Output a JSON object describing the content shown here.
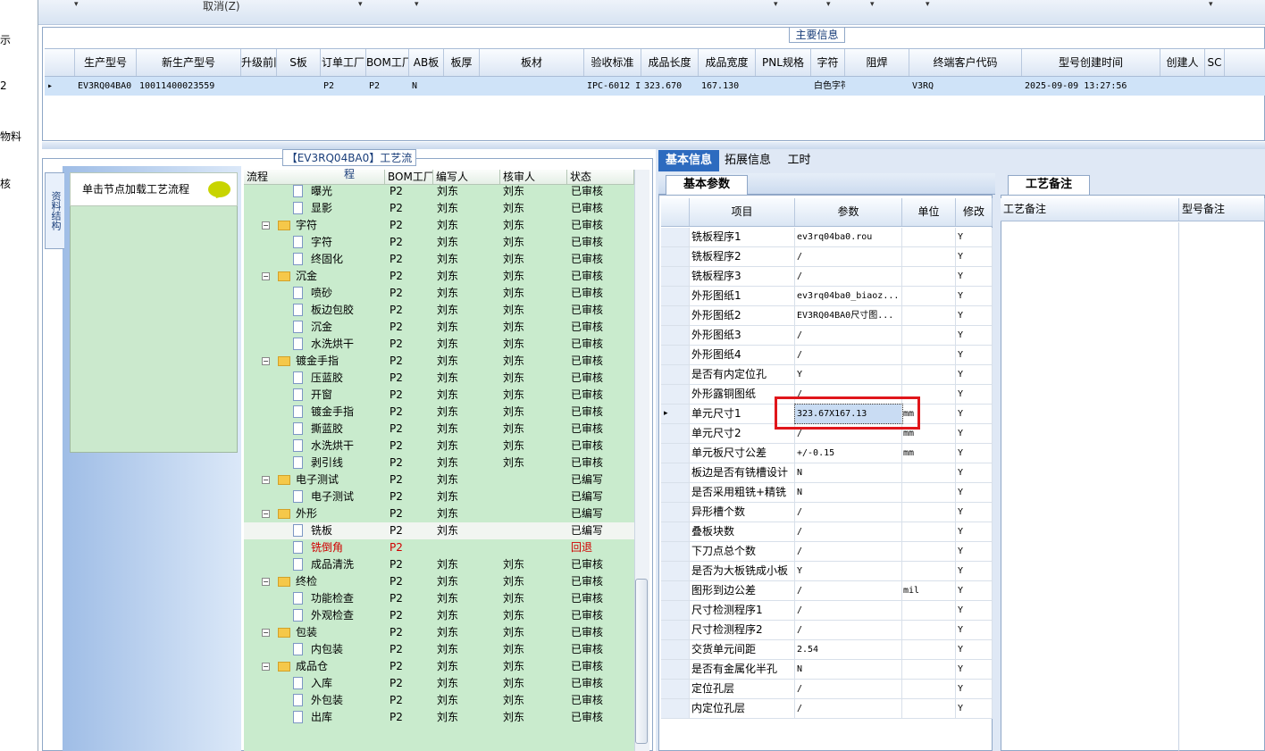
{
  "left_strip": [
    "示",
    "2",
    "物料",
    "核"
  ],
  "toolbar": {
    "cancel_label": "取消(Z)"
  },
  "main_group_title": "主要信息",
  "main_columns": [
    "生产型号",
    "新生产型号",
    "升级前旧生产型号",
    "S板",
    "订单工厂",
    "BOM工厂",
    "AB板",
    "板厚",
    "板材",
    "验收标准",
    "成品长度",
    "成品宽度",
    "PNL规格",
    "字符",
    "阻焊",
    "终端客户代码",
    "型号创建时间",
    "创建人",
    "SC"
  ],
  "main_row": [
    "EV3RQ04BA0",
    "10011400023559",
    "",
    "",
    "P2",
    "P2",
    "N",
    "",
    "",
    "IPC-6012 III级",
    "323.670",
    "167.130",
    "",
    "白色字符",
    "",
    "V3RQ",
    "2025-09-09 13:27:56",
    "",
    ""
  ],
  "process_title": "【EV3RQ04BA0】工艺流程",
  "vertical_tab": "资料结构",
  "hint_text": "单击节点加载工艺流程",
  "tree_columns": [
    "流程",
    "BOM工厂",
    "编写人",
    "核审人",
    "状态"
  ],
  "tree_rows": [
    {
      "level": 2,
      "name": "曝光",
      "bom": "P2",
      "writer": "刘东",
      "reviewer": "刘东",
      "status": "已审核"
    },
    {
      "level": 2,
      "name": "显影",
      "bom": "P2",
      "writer": "刘东",
      "reviewer": "刘东",
      "status": "已审核"
    },
    {
      "level": 1,
      "name": "字符",
      "bom": "P2",
      "writer": "刘东",
      "reviewer": "刘东",
      "status": "已审核"
    },
    {
      "level": 2,
      "name": "字符",
      "bom": "P2",
      "writer": "刘东",
      "reviewer": "刘东",
      "status": "已审核"
    },
    {
      "level": 2,
      "name": "终固化",
      "bom": "P2",
      "writer": "刘东",
      "reviewer": "刘东",
      "status": "已审核"
    },
    {
      "level": 1,
      "name": "沉金",
      "bom": "P2",
      "writer": "刘东",
      "reviewer": "刘东",
      "status": "已审核"
    },
    {
      "level": 2,
      "name": "喷砂",
      "bom": "P2",
      "writer": "刘东",
      "reviewer": "刘东",
      "status": "已审核"
    },
    {
      "level": 2,
      "name": "板边包胶",
      "bom": "P2",
      "writer": "刘东",
      "reviewer": "刘东",
      "status": "已审核"
    },
    {
      "level": 2,
      "name": "沉金",
      "bom": "P2",
      "writer": "刘东",
      "reviewer": "刘东",
      "status": "已审核"
    },
    {
      "level": 2,
      "name": "水洗烘干",
      "bom": "P2",
      "writer": "刘东",
      "reviewer": "刘东",
      "status": "已审核"
    },
    {
      "level": 1,
      "name": "镀金手指",
      "bom": "P2",
      "writer": "刘东",
      "reviewer": "刘东",
      "status": "已审核"
    },
    {
      "level": 2,
      "name": "压蓝胶",
      "bom": "P2",
      "writer": "刘东",
      "reviewer": "刘东",
      "status": "已审核"
    },
    {
      "level": 2,
      "name": "开窗",
      "bom": "P2",
      "writer": "刘东",
      "reviewer": "刘东",
      "status": "已审核"
    },
    {
      "level": 2,
      "name": "镀金手指",
      "bom": "P2",
      "writer": "刘东",
      "reviewer": "刘东",
      "status": "已审核"
    },
    {
      "level": 2,
      "name": "撕蓝胶",
      "bom": "P2",
      "writer": "刘东",
      "reviewer": "刘东",
      "status": "已审核"
    },
    {
      "level": 2,
      "name": "水洗烘干",
      "bom": "P2",
      "writer": "刘东",
      "reviewer": "刘东",
      "status": "已审核"
    },
    {
      "level": 2,
      "name": "剥引线",
      "bom": "P2",
      "writer": "刘东",
      "reviewer": "刘东",
      "status": "已审核"
    },
    {
      "level": 1,
      "name": "电子测试",
      "bom": "P2",
      "writer": "刘东",
      "reviewer": "",
      "status": "已编写"
    },
    {
      "level": 2,
      "name": "电子测试",
      "bom": "P2",
      "writer": "刘东",
      "reviewer": "",
      "status": "已编写"
    },
    {
      "level": 1,
      "name": "外形",
      "bom": "P2",
      "writer": "刘东",
      "reviewer": "",
      "status": "已编写"
    },
    {
      "level": 2,
      "name": "铣板",
      "bom": "P2",
      "writer": "刘东",
      "reviewer": "",
      "status": "已编写",
      "selected": true
    },
    {
      "level": 2,
      "name": "铣倒角",
      "bom": "P2",
      "writer": "",
      "reviewer": "",
      "status": "回退",
      "red": true
    },
    {
      "level": 2,
      "name": "成品清洗",
      "bom": "P2",
      "writer": "刘东",
      "reviewer": "刘东",
      "status": "已审核"
    },
    {
      "level": 1,
      "name": "终检",
      "bom": "P2",
      "writer": "刘东",
      "reviewer": "刘东",
      "status": "已审核"
    },
    {
      "level": 2,
      "name": "功能检查",
      "bom": "P2",
      "writer": "刘东",
      "reviewer": "刘东",
      "status": "已审核"
    },
    {
      "level": 2,
      "name": "外观检查",
      "bom": "P2",
      "writer": "刘东",
      "reviewer": "刘东",
      "status": "已审核"
    },
    {
      "level": 1,
      "name": "包装",
      "bom": "P2",
      "writer": "刘东",
      "reviewer": "刘东",
      "status": "已审核"
    },
    {
      "level": 2,
      "name": "内包装",
      "bom": "P2",
      "writer": "刘东",
      "reviewer": "刘东",
      "status": "已审核"
    },
    {
      "level": 1,
      "name": "成品仓",
      "bom": "P2",
      "writer": "刘东",
      "reviewer": "刘东",
      "status": "已审核"
    },
    {
      "level": 2,
      "name": "入库",
      "bom": "P2",
      "writer": "刘东",
      "reviewer": "刘东",
      "status": "已审核"
    },
    {
      "level": 2,
      "name": "外包装",
      "bom": "P2",
      "writer": "刘东",
      "reviewer": "刘东",
      "status": "已审核"
    },
    {
      "level": 2,
      "name": "出库",
      "bom": "P2",
      "writer": "刘东",
      "reviewer": "刘东",
      "status": "已审核"
    }
  ],
  "right_tabs": [
    "基本信息",
    "拓展信息",
    "工时"
  ],
  "param_tab": "基本参数",
  "param_columns": [
    "项目",
    "参数",
    "单位",
    "修改"
  ],
  "param_rows": [
    [
      "铣板程序1",
      "ev3rq04ba0.rou",
      "",
      "Y"
    ],
    [
      "铣板程序2",
      "/",
      "",
      "Y"
    ],
    [
      "铣板程序3",
      "/",
      "",
      "Y"
    ],
    [
      "外形图纸1",
      "ev3rq04ba0_biaoz...",
      "",
      "Y"
    ],
    [
      "外形图纸2",
      "EV3RQ04BA0尺寸图...",
      "",
      "Y"
    ],
    [
      "外形图纸3",
      "/",
      "",
      "Y"
    ],
    [
      "外形图纸4",
      "/",
      "",
      "Y"
    ],
    [
      "是否有内定位孔",
      "Y",
      "",
      "Y"
    ],
    [
      "外形露铜图纸",
      "/",
      "",
      "Y"
    ],
    [
      "单元尺寸1",
      "323.67X167.13",
      "mm",
      "Y"
    ],
    [
      "单元尺寸2",
      "/",
      "mm",
      "Y"
    ],
    [
      "单元板尺寸公差",
      "+/-0.15",
      "mm",
      "Y"
    ],
    [
      "板边是否有铣槽设计",
      "N",
      "",
      "Y"
    ],
    [
      "是否采用粗铣+精铣",
      "N",
      "",
      "Y"
    ],
    [
      "异形槽个数",
      "/",
      "",
      "Y"
    ],
    [
      "叠板块数",
      "/",
      "",
      "Y"
    ],
    [
      "下刀点总个数",
      "/",
      "",
      "Y"
    ],
    [
      "是否为大板铣成小板",
      "Y",
      "",
      "Y"
    ],
    [
      "图形到边公差",
      "/",
      "mil",
      "Y"
    ],
    [
      "尺寸检测程序1",
      "/",
      "",
      "Y"
    ],
    [
      "尺寸检测程序2",
      "/",
      "",
      "Y"
    ],
    [
      "交货单元间距",
      "2.54",
      "",
      "Y"
    ],
    [
      "是否有金属化半孔",
      "N",
      "",
      "Y"
    ],
    [
      "定位孔层",
      "/",
      "",
      "Y"
    ],
    [
      "内定位孔层",
      "/",
      "",
      "Y"
    ]
  ],
  "remark_tab": "工艺备注",
  "remark_columns": [
    "工艺备注",
    "型号备注"
  ]
}
